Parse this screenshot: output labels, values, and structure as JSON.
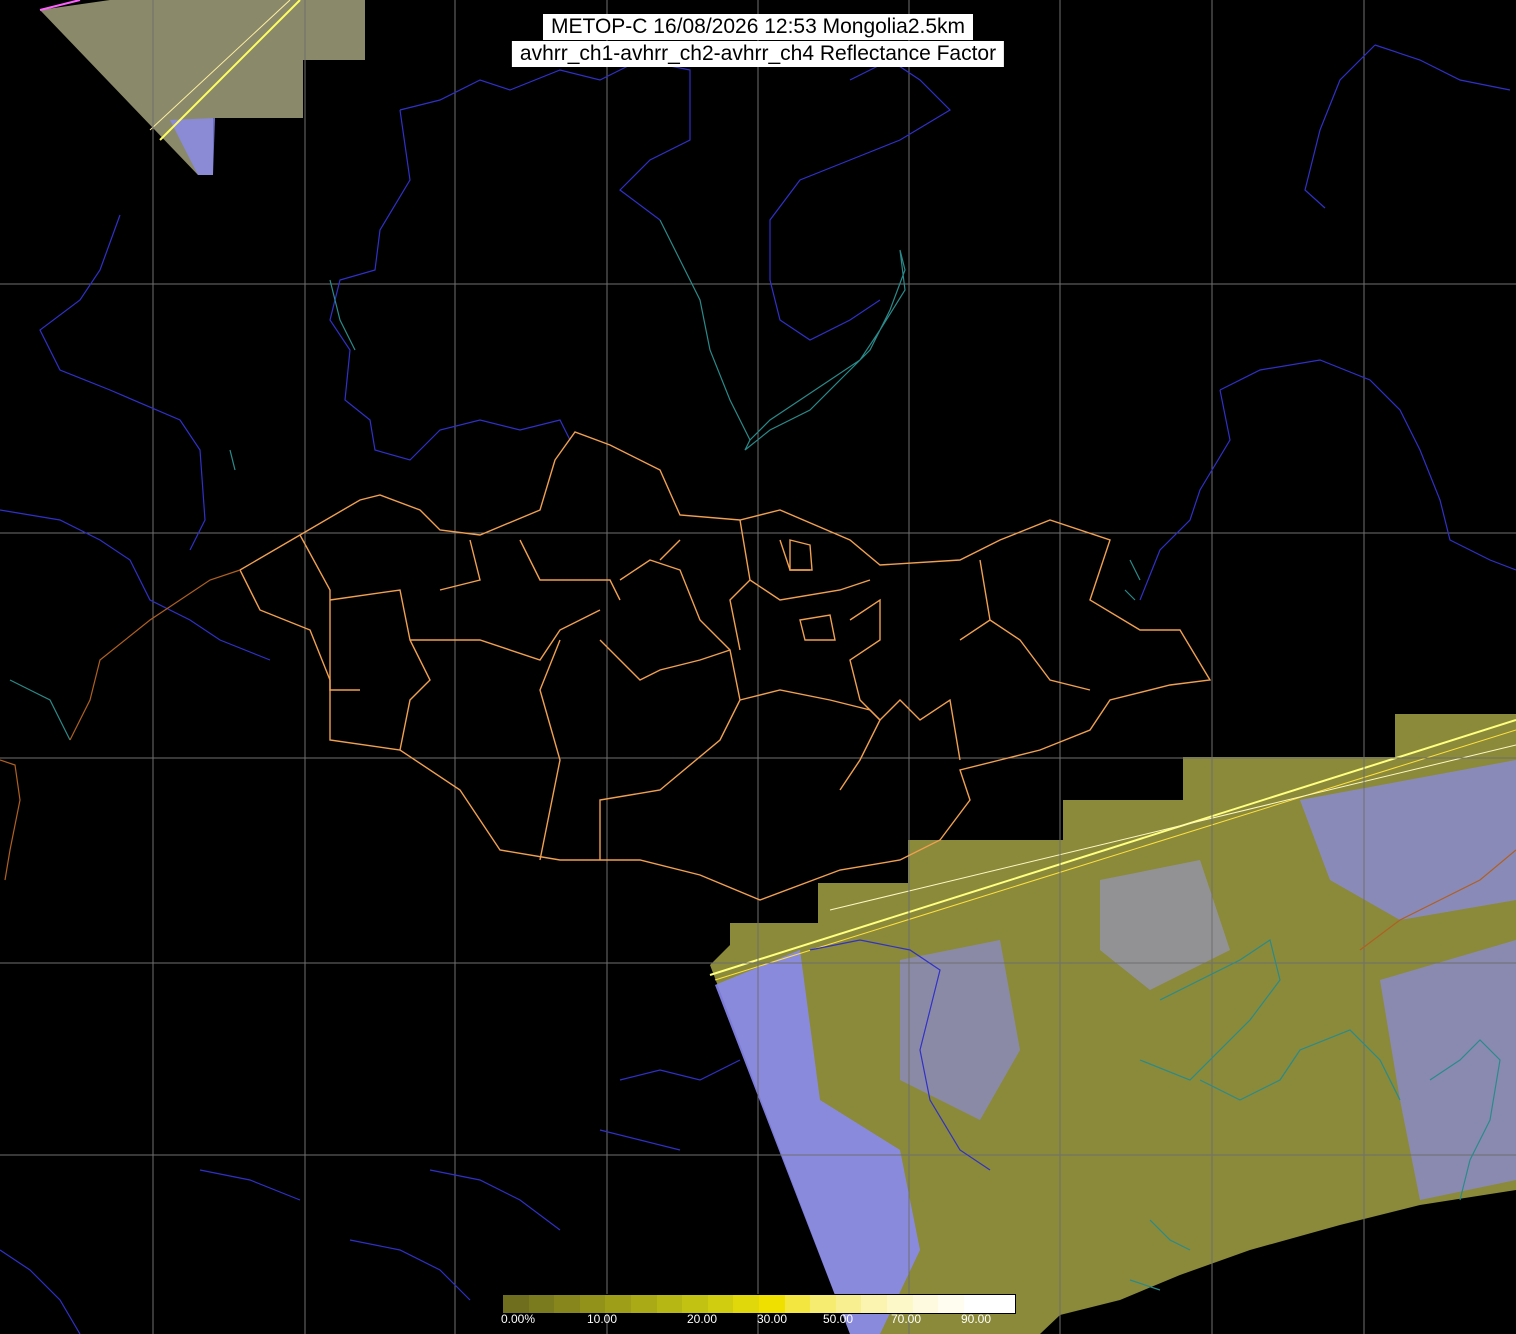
{
  "header": {
    "line1": "METOP-C 16/08/2026 12:53 Mongolia2.5km",
    "line2": "avhrr_ch1-avhrr_ch2-avhrr_ch4 Reflectance Factor"
  },
  "colors": {
    "background": "#000000",
    "graticule": "#6f6f6f",
    "rivers_borders": "#3030c8",
    "coastlines": "#2a8a8a",
    "mongolia_provinces": "#f0a050",
    "clear_ground": "#8a8a30",
    "cloud": "#8a8af0"
  },
  "colorbar": {
    "segments": [
      "#6e6e1e",
      "#7a7a1e",
      "#86861c",
      "#92921a",
      "#9e9e18",
      "#aaaa16",
      "#b6b614",
      "#c2c212",
      "#d0cc10",
      "#e0d80a",
      "#f0e000",
      "#f4e640",
      "#f6ec70",
      "#f8f090",
      "#faf4b0",
      "#fcf8c8",
      "#fefae0",
      "#fffcf0",
      "#ffffff",
      "#ffffff"
    ],
    "ticks": [
      "0.00%",
      "10.00",
      "20.00",
      "30.00",
      "50.00",
      "70.00",
      "90.00"
    ]
  }
}
